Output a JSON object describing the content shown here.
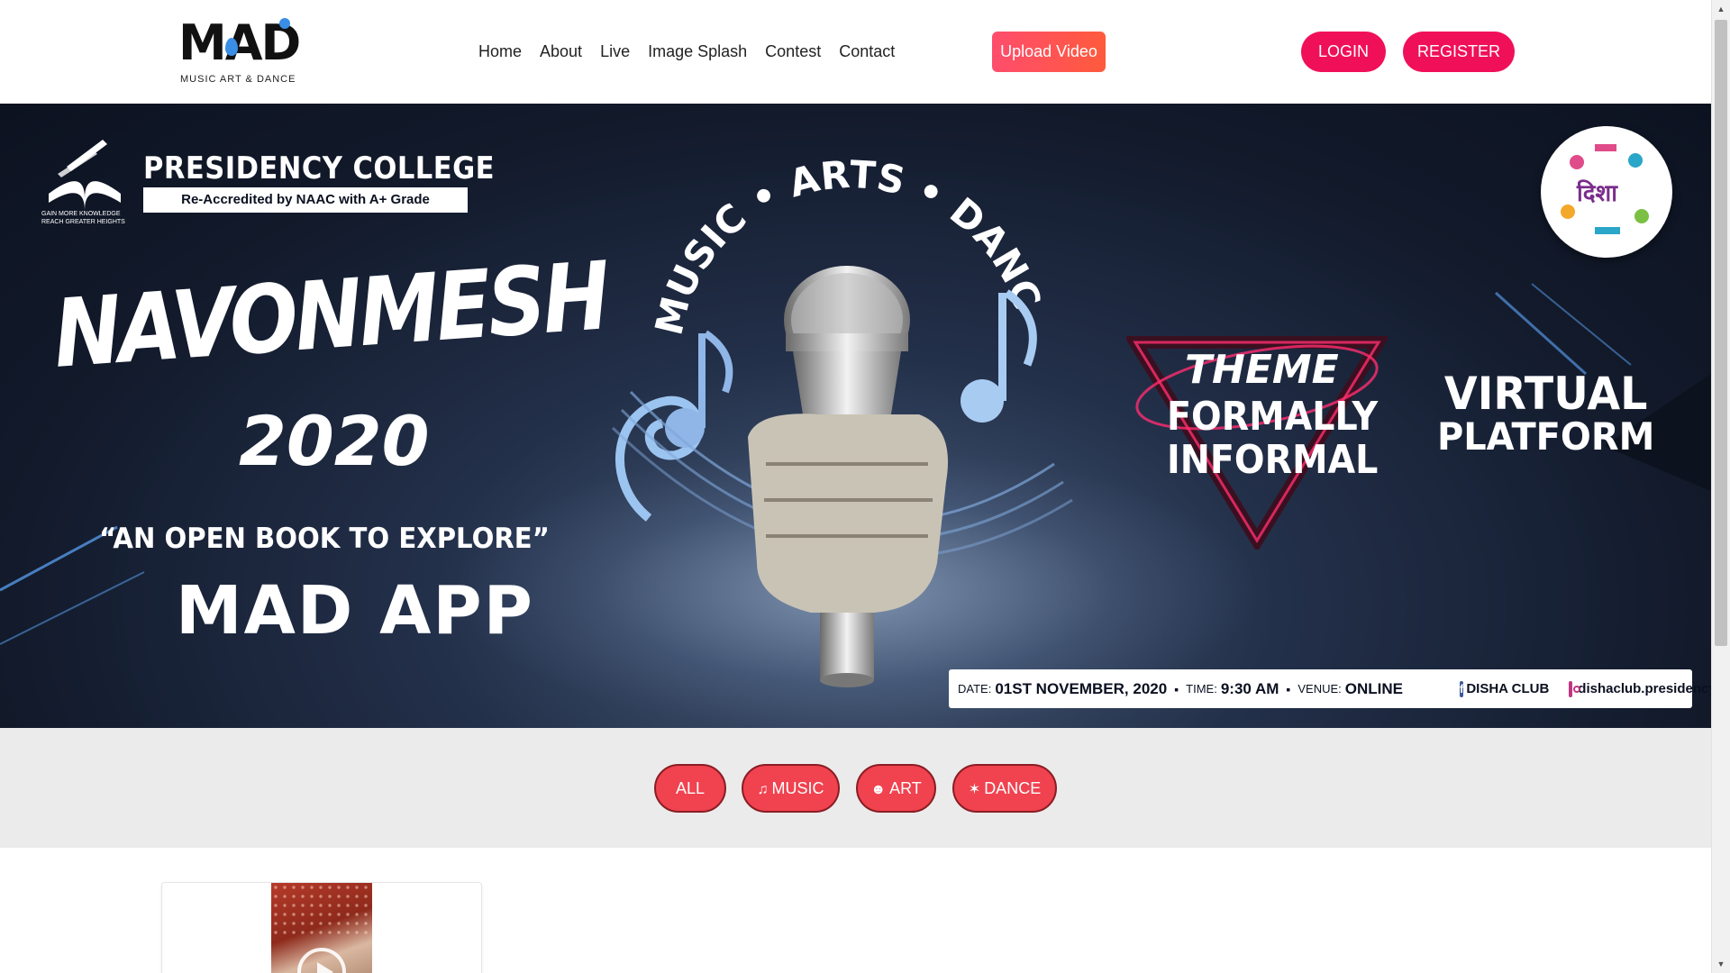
{
  "brand": {
    "logo_word": "MAD",
    "logo_subtitle": "MUSIC ART & DANCE"
  },
  "nav": {
    "items": [
      {
        "label": "Home"
      },
      {
        "label": "About"
      },
      {
        "label": "Live"
      },
      {
        "label": "Image Splash"
      },
      {
        "label": "Contest"
      },
      {
        "label": "Contact"
      }
    ]
  },
  "header_actions": {
    "upload_label": "Upload Video",
    "login_label": "LOGIN",
    "register_label": "REGISTER"
  },
  "banner": {
    "college_name": "PRESIDENCY COLLEGE",
    "college_accreditation": "Re-Accredited by NAAC with A+ Grade",
    "college_tagline": "GAIN MORE KNOWLEDGE REACH GREATER HEIGHTS",
    "arc_text": "MUSIC • ARTS • DANCE",
    "event_name": "NAVONMESH",
    "event_year": "2020",
    "tagline": "“AN OPEN BOOK TO EXPLORE”",
    "app_name": "MAD APP",
    "theme_line1": "THEME",
    "theme_line2": "FORMALLY",
    "theme_line3": "INFORMAL",
    "platform_line1": "VIRTUAL",
    "platform_line2": "PLATFORM",
    "badge_text": "दिशा",
    "info": {
      "date_label": "DATE:",
      "date_value": "01ST NOVEMBER, 2020",
      "time_label": "TIME:",
      "time_value": "9:30 AM",
      "venue_label": "VENUE:",
      "venue_value": "ONLINE",
      "facebook_handle": "DISHA CLUB",
      "instagram_handle": "dishaclub.presidency"
    }
  },
  "filters": {
    "all_label": "ALL",
    "music_label": "MUSIC",
    "art_label": "ART",
    "dance_label": "DANCE"
  },
  "colors": {
    "accent": "#f0105a",
    "filter_button": "#f0424f",
    "filter_border": "#8a1d23",
    "banner_bg": "#121a2b"
  },
  "icons": {
    "music": "music-note-icon",
    "art": "theater-masks-icon",
    "dance": "dancer-icon",
    "play": "play-circle-icon"
  }
}
